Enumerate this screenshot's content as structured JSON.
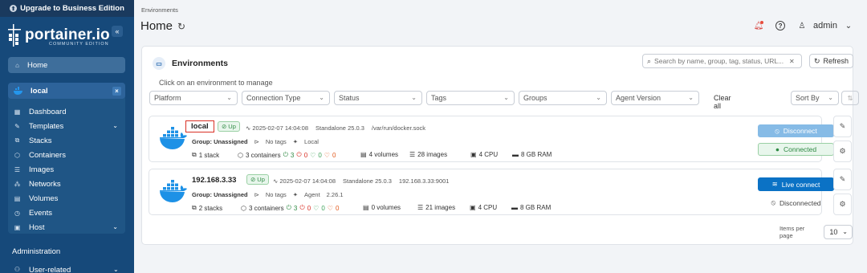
{
  "upgrade": {
    "label": "Upgrade to Business Edition"
  },
  "brand": {
    "name": "portainer.io",
    "edition": "COMMUNITY EDITION"
  },
  "sidebar": {
    "home": "Home",
    "environment": {
      "name": "local"
    },
    "menu": [
      {
        "label": "Dashboard",
        "icon": "dashboard-icon",
        "has_chevron": false
      },
      {
        "label": "Templates",
        "icon": "edit-icon",
        "has_chevron": true
      },
      {
        "label": "Stacks",
        "icon": "stacks-icon",
        "has_chevron": false
      },
      {
        "label": "Containers",
        "icon": "container-icon",
        "has_chevron": false
      },
      {
        "label": "Images",
        "icon": "list-icon",
        "has_chevron": false
      },
      {
        "label": "Networks",
        "icon": "network-icon",
        "has_chevron": false
      },
      {
        "label": "Volumes",
        "icon": "database-icon",
        "has_chevron": false
      },
      {
        "label": "Events",
        "icon": "clock-icon",
        "has_chevron": false
      },
      {
        "label": "Host",
        "icon": "host-icon",
        "has_chevron": true
      }
    ],
    "administration": "Administration",
    "user_related": "User-related"
  },
  "header": {
    "breadcrumb": "Environments",
    "title": "Home",
    "user": "admin"
  },
  "panel": {
    "title": "Environments",
    "search_placeholder": "Search by name, group, tag, status, URL...",
    "refresh": "Refresh",
    "hint": "Click on an environment to manage",
    "filters": [
      "Platform",
      "Connection Type",
      "Status",
      "Tags",
      "Groups",
      "Agent Version"
    ],
    "clear_all": "Clear all",
    "sort_by": "Sort By"
  },
  "environments": [
    {
      "name": "local",
      "status": "Up",
      "heartbeat": "2025-02-07 14:04:08",
      "type": "Standalone 25.0.3",
      "url": "/var/run/docker.sock",
      "group": "Group: Unassigned",
      "tags": "No tags",
      "kind": "Local",
      "agent_version": "",
      "stacks": "1 stack",
      "containers": "3 containers",
      "running": "3",
      "stopped": "0",
      "healthy": "0",
      "unhealthy": "0",
      "volumes": "4 volumes",
      "images": "28 images",
      "cpu": "4 CPU",
      "ram": "8 GB RAM",
      "primary_action": "Disconnect",
      "connection_state": "Connected"
    },
    {
      "name": "192.168.3.33",
      "status": "Up",
      "heartbeat": "2025-02-07 14:04:08",
      "type": "Standalone 25.0.3",
      "url": "192.168.3.33:9001",
      "group": "Group: Unassigned",
      "tags": "No tags",
      "kind": "Agent",
      "agent_version": "2.26.1",
      "stacks": "2 stacks",
      "containers": "3 containers",
      "running": "3",
      "stopped": "0",
      "healthy": "0",
      "unhealthy": "0",
      "volumes": "0 volumes",
      "images": "21 images",
      "cpu": "4 CPU",
      "ram": "8 GB RAM",
      "primary_action": "Live connect",
      "connection_state": "Disconnected"
    }
  ],
  "pagination": {
    "label": "Items per page",
    "value": "10"
  },
  "colors": {
    "sidebar": "#16497a",
    "primary": "#0b72c5",
    "success": "#2f8a44",
    "danger": "#d93025",
    "docker": "#1d91e6"
  }
}
